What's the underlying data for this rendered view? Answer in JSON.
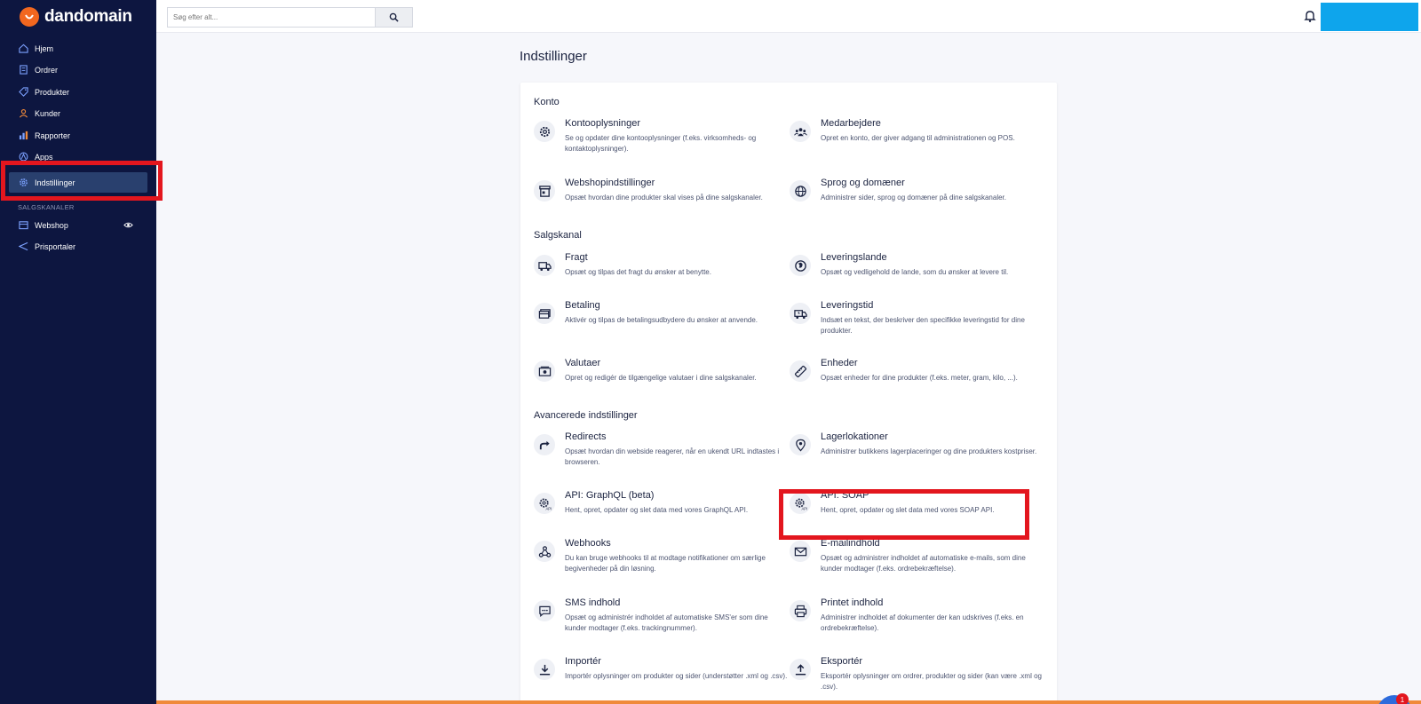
{
  "app": {
    "logo_text": "dandomain"
  },
  "sidebar": {
    "items": [
      {
        "label": "Hjem",
        "icon": "home-icon"
      },
      {
        "label": "Ordrer",
        "icon": "orders-icon"
      },
      {
        "label": "Produkter",
        "icon": "tag-icon"
      },
      {
        "label": "Kunder",
        "icon": "user-icon"
      },
      {
        "label": "Rapporter",
        "icon": "chart-icon"
      },
      {
        "label": "Apps",
        "icon": "apps-icon"
      },
      {
        "label": "Indstillinger",
        "icon": "gear-icon",
        "active": true
      }
    ],
    "section_label": "SALGSKANALER",
    "channels": [
      {
        "label": "Webshop",
        "icon": "store-icon"
      },
      {
        "label": "Prisportaler",
        "icon": "send-icon"
      }
    ]
  },
  "search": {
    "placeholder": "Søg efter alt..."
  },
  "page": {
    "title": "Indstillinger"
  },
  "sections": {
    "konto": {
      "title": "Konto",
      "items": [
        {
          "title": "Kontooplysninger",
          "desc": "Se og opdater dine kontooplysninger (f.eks. virksomheds- og kontaktoplysninger).",
          "icon": "gear-icon"
        },
        {
          "title": "Medarbejdere",
          "desc": "Opret en konto, der giver adgang til administrationen og POS.",
          "icon": "team-icon"
        },
        {
          "title": "Webshopindstillinger",
          "desc": "Opsæt hvordan dine produkter skal vises på dine salgskanaler.",
          "icon": "store-icon"
        },
        {
          "title": "Sprog og domæner",
          "desc": "Administrer sider, sprog og domæner på dine salgskanaler.",
          "icon": "globe-icon"
        }
      ]
    },
    "salgskanal": {
      "title": "Salgskanal",
      "items": [
        {
          "title": "Fragt",
          "desc": "Opsæt og tilpas det fragt du ønsker at benytte.",
          "icon": "truck-icon"
        },
        {
          "title": "Leveringslande",
          "desc": "Opsæt og vedligehold de lande, som du ønsker at levere til.",
          "icon": "globe-refresh-icon"
        },
        {
          "title": "Betaling",
          "desc": "Aktivér og tilpas de betalingsudbydere du ønsker at anvende.",
          "icon": "card-icon"
        },
        {
          "title": "Leveringstid",
          "desc": "Indsæt en tekst, der beskriver den specifikke leveringstid for dine produkter.",
          "icon": "delivery-time-icon"
        },
        {
          "title": "Valutaer",
          "desc": "Opret og redigér de tilgængelige valutaer i dine salgskanaler.",
          "icon": "money-icon"
        },
        {
          "title": "Enheder",
          "desc": "Opsæt enheder for dine produkter (f.eks. meter, gram, kilo, ...).",
          "icon": "ruler-icon"
        }
      ]
    },
    "avancerede": {
      "title": "Avancerede indstillinger",
      "items": [
        {
          "title": "Redirects",
          "desc": "Opsæt hvordan din webside reagerer, når en ukendt URL indtastes i browseren.",
          "icon": "redirect-icon"
        },
        {
          "title": "Lagerlokationer",
          "desc": "Administrer butikkens lagerplaceringer og dine produkters kostpriser.",
          "icon": "location-pin-icon"
        },
        {
          "title": "API: GraphQL (beta)",
          "desc": "Hent, opret, opdater og slet data med vores GraphQL API.",
          "icon": "api-gear-icon"
        },
        {
          "title": "API: SOAP",
          "desc": "Hent, opret, opdater og slet data med vores SOAP API.",
          "icon": "api-gear-icon"
        },
        {
          "title": "Webhooks",
          "desc": "Du kan bruge webhooks til at modtage notifikationer om særlige begivenheder på din løsning.",
          "icon": "webhook-icon"
        },
        {
          "title": "E-mailindhold",
          "desc": "Opsæt og administrer indholdet af automatiske e-mails, som dine kunder modtager (f.eks. ordrebekræftelse).",
          "icon": "mail-icon"
        },
        {
          "title": "SMS indhold",
          "desc": "Opsæt og administrér indholdet af automatiske SMS'er som dine kunder modtager (f.eks. trackingnummer).",
          "icon": "sms-icon"
        },
        {
          "title": "Printet indhold",
          "desc": "Administrer indholdet af dokumenter der kan udskrives (f.eks. en ordrebekræftelse).",
          "icon": "printer-icon"
        },
        {
          "title": "Importér",
          "desc": "Importér oplysninger om produkter og sider (understøtter .xml og .csv).",
          "icon": "import-icon"
        },
        {
          "title": "Eksportér",
          "desc": "Eksportér oplysninger om ordrer, produkter og sider (kan være .xml og .csv).",
          "icon": "export-icon"
        }
      ]
    }
  },
  "chat": {
    "badge": "1"
  }
}
